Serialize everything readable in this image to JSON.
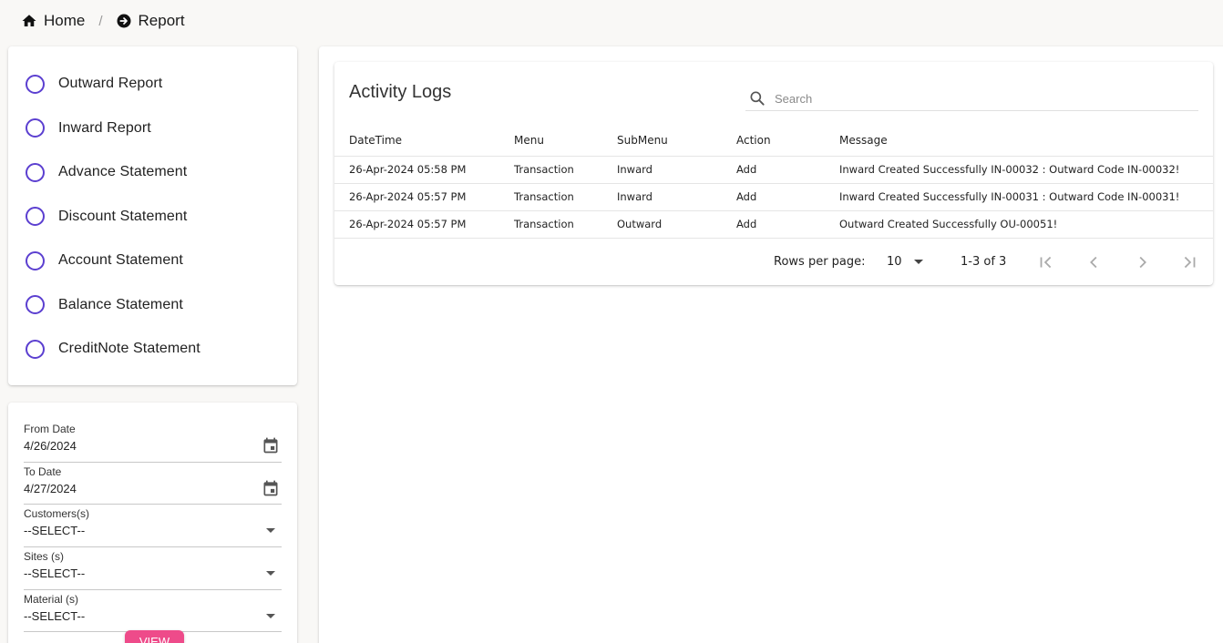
{
  "breadcrumb": {
    "home_label": "Home",
    "separator": "/",
    "current_label": "Report"
  },
  "report_options": [
    {
      "label": "Outward Report"
    },
    {
      "label": "Inward Report"
    },
    {
      "label": "Advance Statement"
    },
    {
      "label": "Discount Statement"
    },
    {
      "label": "Account Statement"
    },
    {
      "label": "Balance Statement"
    },
    {
      "label": "CreditNote Statement"
    }
  ],
  "filters": {
    "from_date": {
      "label": "From Date",
      "value": "4/26/2024"
    },
    "to_date": {
      "label": "To Date",
      "value": "4/27/2024"
    },
    "customers": {
      "label": "Customers(s)",
      "value": "--SELECT--"
    },
    "sites": {
      "label": "Sites (s)",
      "value": "--SELECT--"
    },
    "material": {
      "label": "Material (s)",
      "value": "--SELECT--"
    },
    "view_label": "VIEW"
  },
  "activity_logs": {
    "title": "Activity Logs",
    "search_placeholder": "Search",
    "columns": [
      "DateTime",
      "Menu",
      "SubMenu",
      "Action",
      "Message"
    ],
    "rows": [
      [
        "26-Apr-2024 05:58 PM",
        "Transaction",
        "Inward",
        "Add",
        "Inward Created Successfully IN-00032 : Outward Code IN-00032!"
      ],
      [
        "26-Apr-2024 05:57 PM",
        "Transaction",
        "Inward",
        "Add",
        "Inward Created Successfully IN-00031 : Outward Code IN-00031!"
      ],
      [
        "26-Apr-2024 05:57 PM",
        "Transaction",
        "Outward",
        "Add",
        "Outward Created Successfully OU-00051!"
      ]
    ],
    "pagination": {
      "rows_per_page_label": "Rows per page:",
      "rows_per_page_value": "10",
      "range_text": "1-3 of 3"
    }
  },
  "colors": {
    "radio_accent": "#5b3fd0",
    "view_button": "#ee4b8a",
    "background": "#f9f8f6"
  }
}
